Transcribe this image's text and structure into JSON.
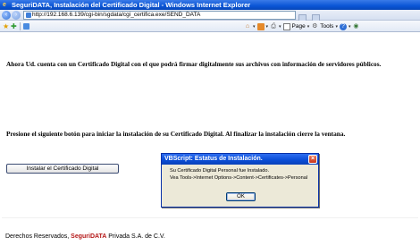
{
  "window": {
    "title": "SeguriDATA, Instalación del Certificado Digital - Windows Internet Explorer"
  },
  "address_bar": {
    "url": "http://192.168.6.139/cgi-bin/sgdata/cgi_certifica.exe/SEND_DATA"
  },
  "command_bar": {
    "page_label": "Page",
    "tools_label": "Tools"
  },
  "content": {
    "message_certificate": "Ahora Ud. cuenta con un Certificado Digital con el que podrá firmar digitalmente sus archivos con información de servidores públicos.",
    "message_instructions": "Presione el siguiente botón para iniciar la instalación de su Certificado Digital. Al finalizar la instalación cierre la ventana.",
    "install_button_label": "Instalar el Certificado Digital"
  },
  "footer": {
    "prefix": "Derechos Reservados, ",
    "brand_part1": "Seguri",
    "brand_part2": "DATA",
    "suffix": " Privada S.A. de C.V."
  },
  "dialog": {
    "title": "VBScript: Estatus de Instalación.",
    "line1": "Su Certificado Digital Personal fue Instalado.",
    "line2": "Vea Tools->Internet Options->Content->Certificates->Personal",
    "ok_label": "OK",
    "close_glyph": "×"
  }
}
